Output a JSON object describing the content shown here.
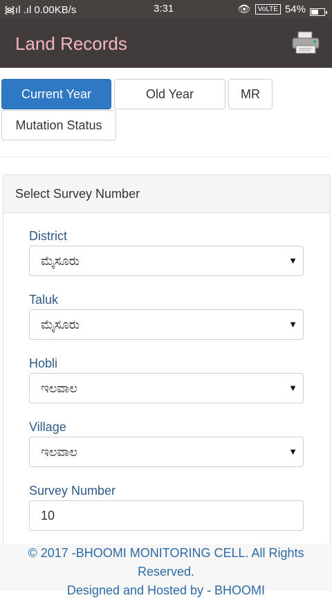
{
  "status_bar": {
    "left": "᯼ıl .ıl 0.00KB/s",
    "time": "3:31",
    "volte": "VoLTE",
    "battery": "54%"
  },
  "app": {
    "title": "Land Records",
    "print_icon": "printer-icon"
  },
  "tabs": [
    {
      "label": "Current Year",
      "active": true
    },
    {
      "label": "Old Year",
      "active": false
    },
    {
      "label": "MR",
      "active": false
    },
    {
      "label": "Mutation Status",
      "active": false
    }
  ],
  "panel": {
    "heading": "Select Survey Number",
    "fields": [
      {
        "label": "District",
        "value": "ಮೈಸೂರು"
      },
      {
        "label": "Taluk",
        "value": "ಮೈಸೂರು"
      },
      {
        "label": "Hobli",
        "value": "ಇಲವಾಲ"
      },
      {
        "label": "Village",
        "value": "ಇಲವಾಲ"
      },
      {
        "label": "Survey Number",
        "value": "10"
      }
    ]
  },
  "footer": {
    "line1": "© 2017 -BHOOMI MONITORING CELL. All Rights",
    "line2": "Reserved.",
    "line3": "Designed and Hosted by - BHOOMI"
  },
  "colors": {
    "appbar": "#413c3b",
    "title": "#f5b7be",
    "active_tab": "#2f78c4",
    "label": "#2d5a87"
  }
}
